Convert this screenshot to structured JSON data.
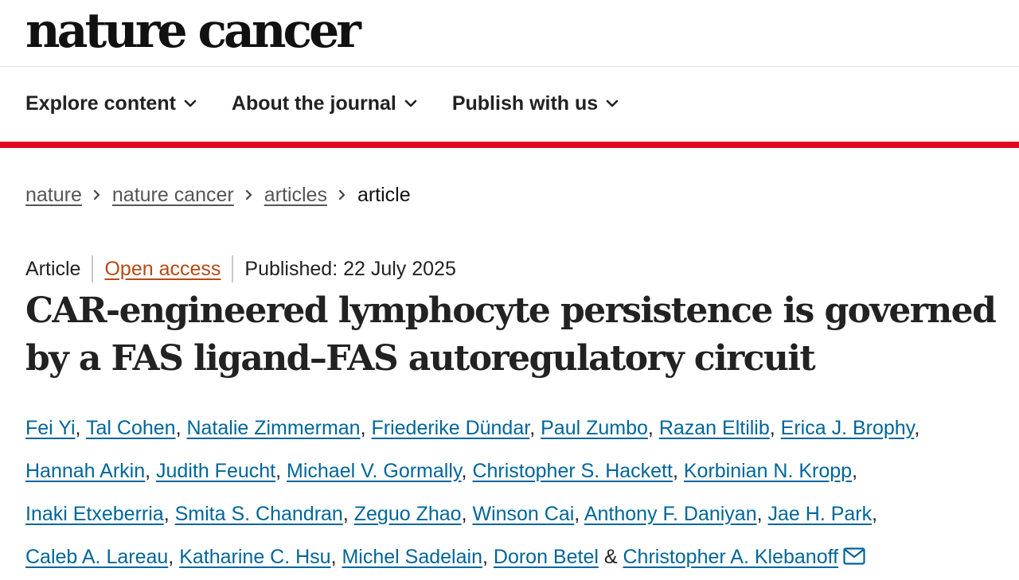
{
  "journal": {
    "name": "nature cancer"
  },
  "nav": [
    {
      "label": "Explore content"
    },
    {
      "label": "About the journal"
    },
    {
      "label": "Publish with us"
    }
  ],
  "breadcrumb": {
    "items": [
      "nature",
      "nature cancer",
      "articles"
    ],
    "current": "article"
  },
  "article": {
    "type": "Article",
    "access": "Open access",
    "published": "Published: 22 July 2025",
    "title": "CAR-engineered lymphocyte persistence is governed by a FAS ligand–FAS autoregulatory circuit",
    "authors": [
      "Fei Yi",
      "Tal Cohen",
      "Natalie Zimmerman",
      "Friederike Dündar",
      "Paul Zumbo",
      "Razan Eltilib",
      "Erica J. Brophy",
      "Hannah Arkin",
      "Judith Feucht",
      "Michael V. Gormally",
      "Christopher S. Hackett",
      "Korbinian N. Kropp",
      "Inaki Etxeberria",
      "Smita S. Chandran",
      "Zeguo Zhao",
      "Winson Cai",
      "Anthony F. Daniyan",
      "Jae H. Park",
      "Caleb A. Lareau",
      "Katharine C. Hsu",
      "Michel Sadelain",
      "Doron Betel",
      "Christopher A. Klebanoff"
    ],
    "author_separator": ", ",
    "last_separator": " & ",
    "correspondence_icon": "envelope-icon"
  },
  "colors": {
    "accent_red": "#e0081f",
    "link_blue": "#006699",
    "open_access_orange": "#b54a14",
    "text": "#222222"
  }
}
